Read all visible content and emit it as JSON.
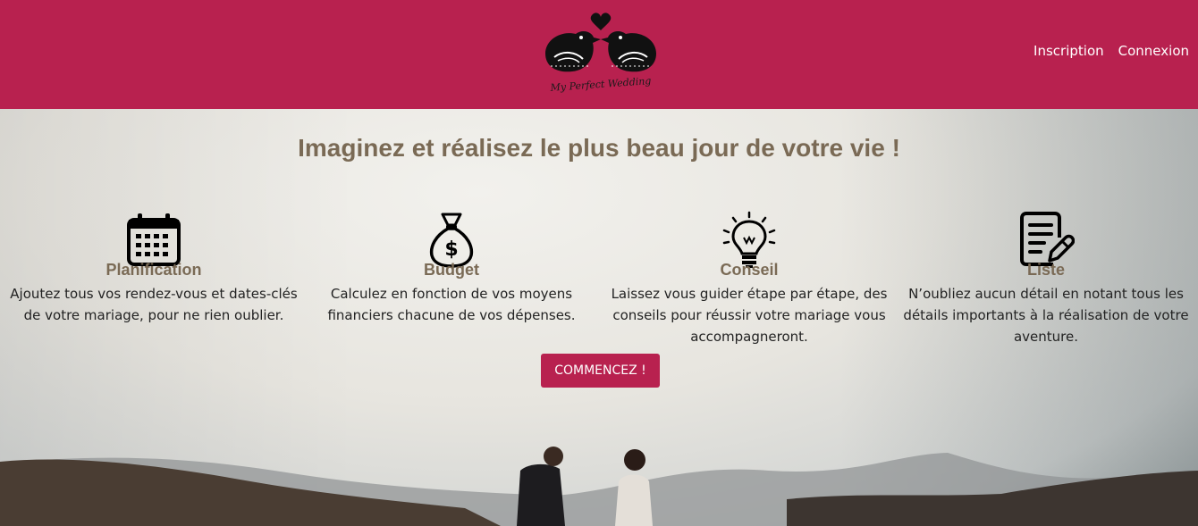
{
  "header": {
    "logo_text": "My Perfect Wedding",
    "nav": [
      {
        "label": "Inscription"
      },
      {
        "label": "Connexion"
      }
    ]
  },
  "hero": {
    "title": "Imaginez et réalisez le plus beau jour de votre vie !",
    "features": [
      {
        "icon": "calendar-icon",
        "title": "Planification",
        "text": "Ajoutez tous vos rendez-vous et dates-clés de votre mariage, pour ne rien oublier."
      },
      {
        "icon": "money-bag-icon",
        "title": "Budget",
        "text": "Calculez en fonction de vos moyens financiers chacune de vos dépenses."
      },
      {
        "icon": "lightbulb-icon",
        "title": "Conseil",
        "text": "Laissez vous guider étape par étape, des conseils pour réussir votre mariage vous accompagneront."
      },
      {
        "icon": "notepad-pen-icon",
        "title": "Liste",
        "text": "N’oubliez aucun détail en notant tous les détails importants à la réalisation de votre aventure."
      }
    ],
    "cta_label": "COMMENCEZ !"
  },
  "colors": {
    "brand": "#b8214f",
    "title": "#7a6a55",
    "text": "#222222"
  }
}
